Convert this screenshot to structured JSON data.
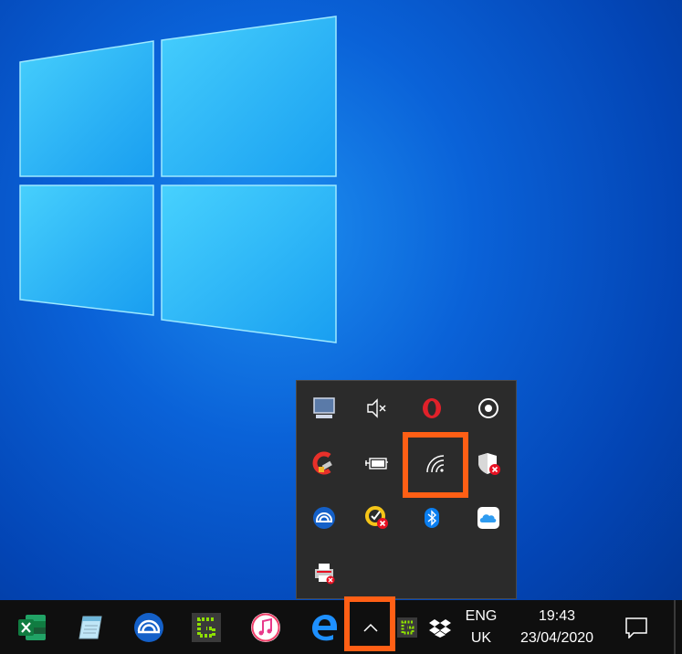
{
  "desktop": {
    "background_color": "#0a62d8",
    "logo_color": "#49c7ff"
  },
  "tray_flyout": {
    "highlight_color": "#ff5f15",
    "icons": [
      {
        "name": "monitor-app-icon",
        "row": 0,
        "col": 0
      },
      {
        "name": "volume-muted-icon",
        "row": 0,
        "col": 1
      },
      {
        "name": "opera-icon",
        "row": 0,
        "col": 2
      },
      {
        "name": "record-circle-icon",
        "row": 0,
        "col": 3
      },
      {
        "name": "ccleaner-icon",
        "row": 1,
        "col": 0
      },
      {
        "name": "battery-power-icon",
        "row": 1,
        "col": 1
      },
      {
        "name": "wireless-network-icon",
        "row": 1,
        "col": 2,
        "highlighted": true
      },
      {
        "name": "windows-security-alert-icon",
        "row": 1,
        "col": 3
      },
      {
        "name": "hotspot-shield-icon",
        "row": 2,
        "col": 0
      },
      {
        "name": "norton-alert-icon",
        "row": 2,
        "col": 1
      },
      {
        "name": "bluetooth-icon",
        "row": 2,
        "col": 2
      },
      {
        "name": "icloud-icon",
        "row": 2,
        "col": 3
      },
      {
        "name": "printer-error-icon",
        "row": 3,
        "col": 0
      }
    ]
  },
  "taskbar": {
    "apps": [
      {
        "name": "excel-icon"
      },
      {
        "name": "notepad-icon"
      },
      {
        "name": "hotspot-shield-taskbar-icon"
      },
      {
        "name": "greenshot-icon"
      },
      {
        "name": "itunes-icon"
      },
      {
        "name": "edge-icon"
      }
    ],
    "show_hidden_icons": {
      "name": "chevron-up-icon"
    },
    "tray_icons": [
      {
        "name": "greenshot-tray-icon"
      },
      {
        "name": "dropbox-icon"
      }
    ],
    "language": {
      "line1": "ENG",
      "line2": "UK"
    },
    "clock": {
      "time": "19:43",
      "date": "23/04/2020"
    },
    "notifications": {
      "name": "action-center-icon"
    }
  }
}
